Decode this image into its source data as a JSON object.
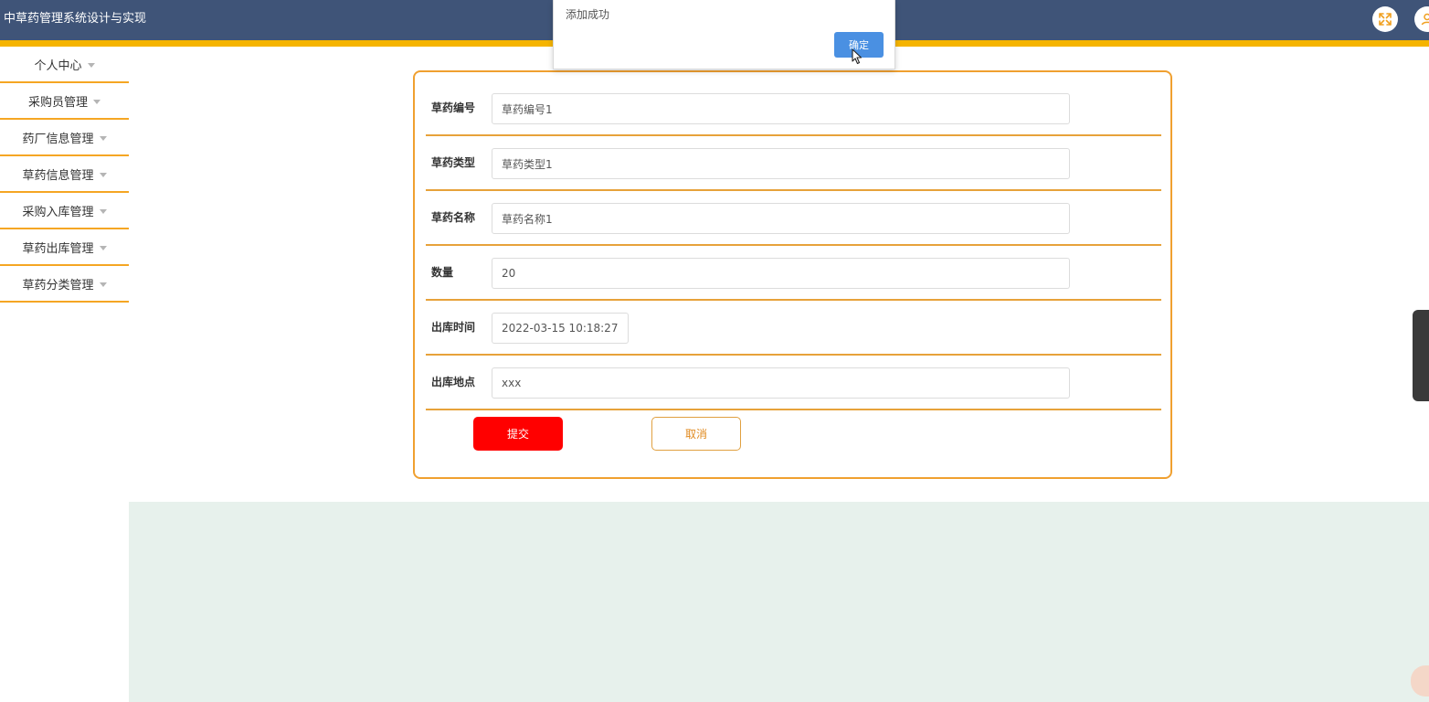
{
  "app": {
    "title": "中草药管理系统设计与实现"
  },
  "header_actions": [
    {
      "name": "fullscreen-icon"
    },
    {
      "name": "user-icon"
    }
  ],
  "sidebar": {
    "items": [
      {
        "label": "个人中心"
      },
      {
        "label": "采购员管理"
      },
      {
        "label": "药厂信息管理"
      },
      {
        "label": "草药信息管理"
      },
      {
        "label": "采购入库管理"
      },
      {
        "label": "草药出库管理"
      },
      {
        "label": "草药分类管理"
      }
    ]
  },
  "form": {
    "fields": [
      {
        "label": "草药编号",
        "value": "草药编号1"
      },
      {
        "label": "草药类型",
        "value": "草药类型1"
      },
      {
        "label": "草药名称",
        "value": "草药名称1"
      },
      {
        "label": "数量",
        "value": "20"
      },
      {
        "label": "出库时间",
        "value": "2022-03-15 10:18:27"
      },
      {
        "label": "出库地点",
        "value": "xxx"
      }
    ],
    "submit_label": "提交",
    "cancel_label": "取消"
  },
  "alert": {
    "message": "添加成功",
    "ok_label": "确定"
  },
  "colors": {
    "header_bg": "#3f5478",
    "accent_stripe": "#f5b400",
    "form_border": "#f0a030",
    "submit_bg": "#ff0000",
    "cancel_text": "#e08a1e",
    "alert_button": "#4a90e2",
    "bottom_bg": "#e7f1ec"
  }
}
